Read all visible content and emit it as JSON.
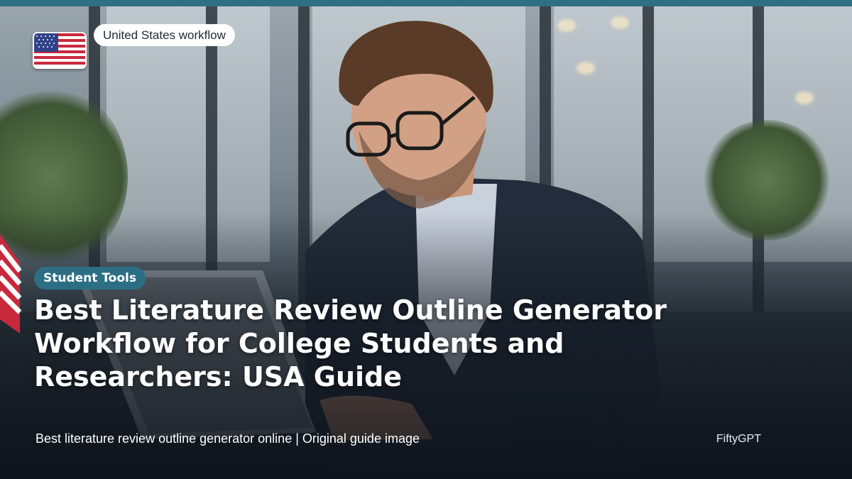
{
  "badge": {
    "flag_icon": "us-flag-icon",
    "region_label": "United States workflow"
  },
  "article": {
    "category": "Student Tools",
    "title": "Best Literature Review Outline Generator Workflow for College Students and Researchers: USA Guide"
  },
  "footer": {
    "caption": "Best literature review outline generator online | Original guide image",
    "brand": "FiftyGPT"
  },
  "colors": {
    "accent": "#2e6f86",
    "category_bg": "#2c6f85",
    "pill_bg": "#ffffff",
    "text": "#ffffff"
  }
}
